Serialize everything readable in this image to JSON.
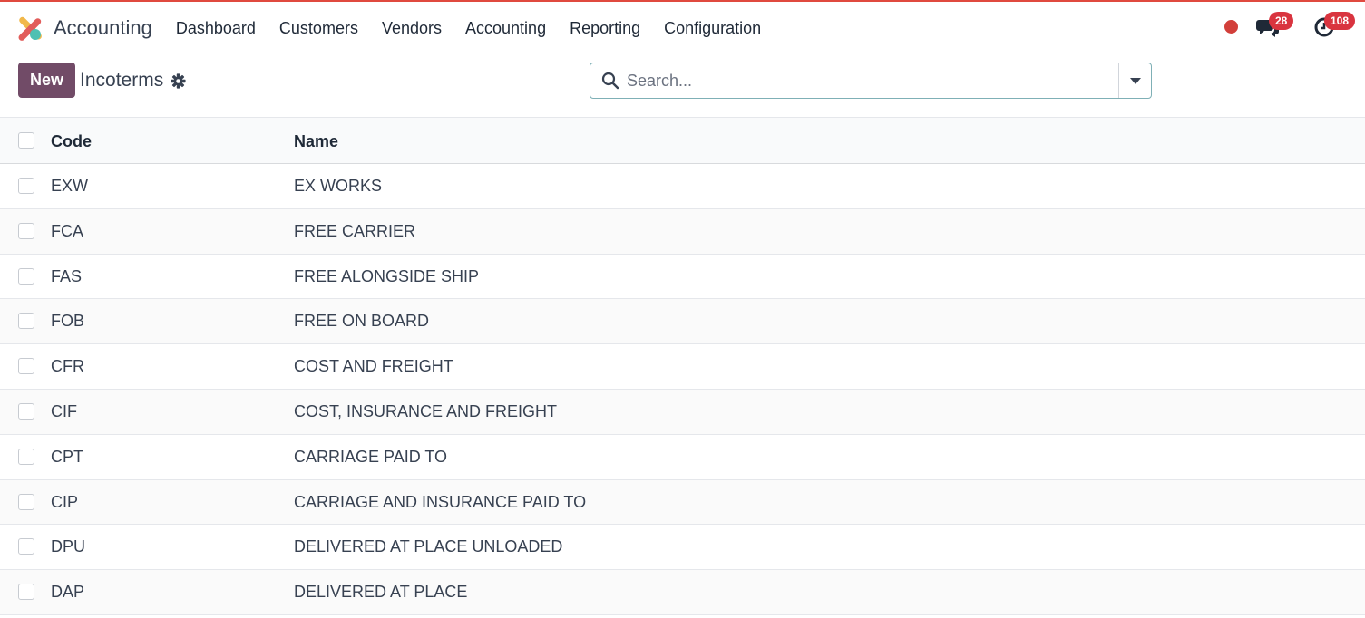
{
  "app": {
    "name": "Accounting",
    "menu": [
      "Dashboard",
      "Customers",
      "Vendors",
      "Accounting",
      "Reporting",
      "Configuration"
    ],
    "logo_icon": "odoo-accounting-logo",
    "accent_color": "#714b67"
  },
  "systray": {
    "status_color": "#d23f3a",
    "messages_count": "28",
    "activities_count": "108"
  },
  "control_panel": {
    "new_label": "New",
    "title": "Incoterms",
    "search_placeholder": "Search..."
  },
  "table": {
    "headers": {
      "code": "Code",
      "name": "Name"
    },
    "rows": [
      {
        "code": "EXW",
        "name": "EX WORKS"
      },
      {
        "code": "FCA",
        "name": "FREE CARRIER"
      },
      {
        "code": "FAS",
        "name": "FREE ALONGSIDE SHIP"
      },
      {
        "code": "FOB",
        "name": "FREE ON BOARD"
      },
      {
        "code": "CFR",
        "name": "COST AND FREIGHT"
      },
      {
        "code": "CIF",
        "name": "COST, INSURANCE AND FREIGHT"
      },
      {
        "code": "CPT",
        "name": "CARRIAGE PAID TO"
      },
      {
        "code": "CIP",
        "name": "CARRIAGE AND INSURANCE PAID TO"
      },
      {
        "code": "DPU",
        "name": "DELIVERED AT PLACE UNLOADED"
      },
      {
        "code": "DAP",
        "name": "DELIVERED AT PLACE"
      }
    ]
  }
}
